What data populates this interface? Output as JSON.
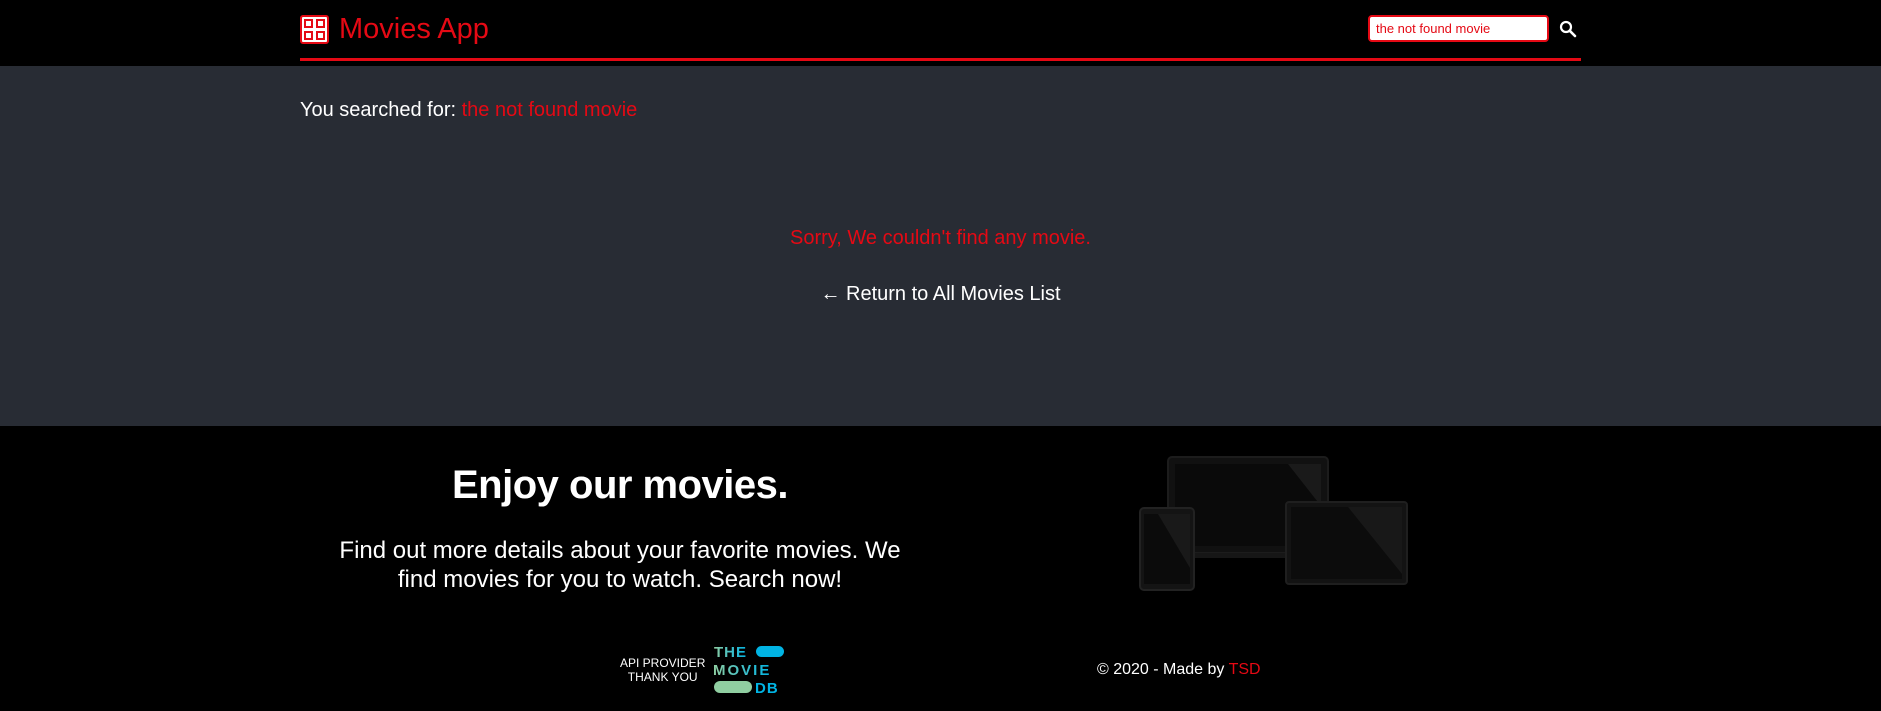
{
  "header": {
    "app_title": "Movies App",
    "logo_icon": "film-grid-icon",
    "search": {
      "value": "the not found movie",
      "placeholder": "",
      "button_icon": "search-icon"
    }
  },
  "main": {
    "searched_label": "You searched for:",
    "searched_query": "the not found movie",
    "not_found_message": "Sorry, We couldn't find any movie.",
    "return_arrow": "←",
    "return_link": "Return to All Movies List"
  },
  "footer": {
    "heading": "Enjoy our movies.",
    "description": "Find out more details about your favorite movies. We find movies for you to watch. Search now!",
    "devices_image": "devices-illustration",
    "api_provider": {
      "line1": "API PROVIDER",
      "line2": "THANK YOU",
      "logo": "tmdb-logo"
    },
    "copyright_prefix": "© 2020 - Made by",
    "copyright_maker": "TSD"
  },
  "colors": {
    "accent": "#e50914",
    "header_bg": "#000000",
    "main_bg": "#282c34",
    "footer_bg": "#000000",
    "text": "#ffffff"
  }
}
